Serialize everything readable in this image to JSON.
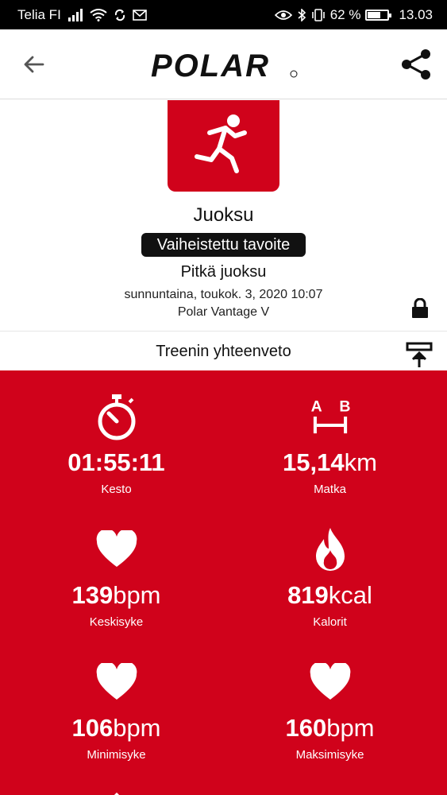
{
  "status_bar": {
    "carrier": "Telia FI",
    "battery": "62 %",
    "battery_level": 0.62,
    "time": "13.03",
    "icons": [
      "signal-icon",
      "wifi-icon",
      "sync-icon",
      "notification-icon",
      "eye-icon",
      "bluetooth-icon",
      "vibrate-icon",
      "battery-icon"
    ]
  },
  "header": {
    "logo_text": "POLAR",
    "back_icon": "back-arrow-icon",
    "share_icon": "share-icon"
  },
  "session": {
    "sport_icon": "running-icon",
    "sport": "Juoksu",
    "phase_badge": "Vaiheistettu tavoite",
    "name": "Pitkä juoksu",
    "date": "sunnuntaina, toukok. 3, 2020 10:07",
    "device": "Polar Vantage V"
  },
  "summary": {
    "title": "Treenin yhteenveto",
    "collapse_icon": "collapse-up-icon"
  },
  "stats": [
    {
      "icon": "stopwatch-icon",
      "value": "01:55:11",
      "unit": "",
      "label": "Kesto"
    },
    {
      "icon": "distance-icon",
      "value": "15,14",
      "unit": "km",
      "label": "Matka"
    },
    {
      "icon": "heart-icon",
      "value": "139",
      "unit": "bpm",
      "label": "Keskisyke"
    },
    {
      "icon": "flame-icon",
      "value": "819",
      "unit": "kcal",
      "label": "Kalorit"
    },
    {
      "icon": "heart-icon",
      "value": "106",
      "unit": "bpm",
      "label": "Minimisyke"
    },
    {
      "icon": "heart-icon",
      "value": "160",
      "unit": "bpm",
      "label": "Maksimisyke"
    }
  ],
  "colors": {
    "brand_red": "#d0021b",
    "text": "#111111",
    "white": "#ffffff"
  }
}
